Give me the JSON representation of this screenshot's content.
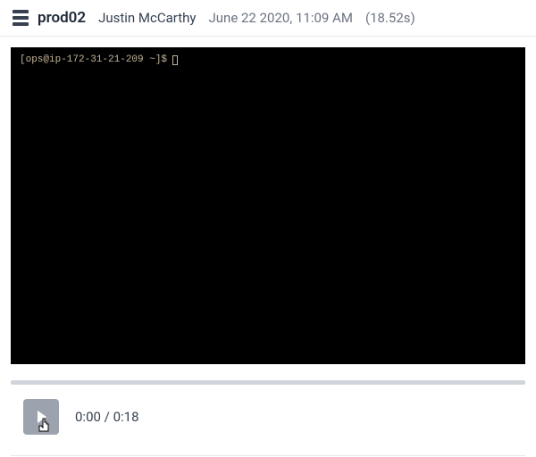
{
  "header": {
    "hostname": "prod02",
    "username": "Justin McCarthy",
    "datetime": "June 22 2020, 11:09 AM",
    "duration": "(18.52s)"
  },
  "terminal": {
    "prompt": "[ops@ip-172-31-21-209 ~]$"
  },
  "playback": {
    "current_time": "0:00",
    "total_time": "0:18",
    "separator": " / "
  }
}
